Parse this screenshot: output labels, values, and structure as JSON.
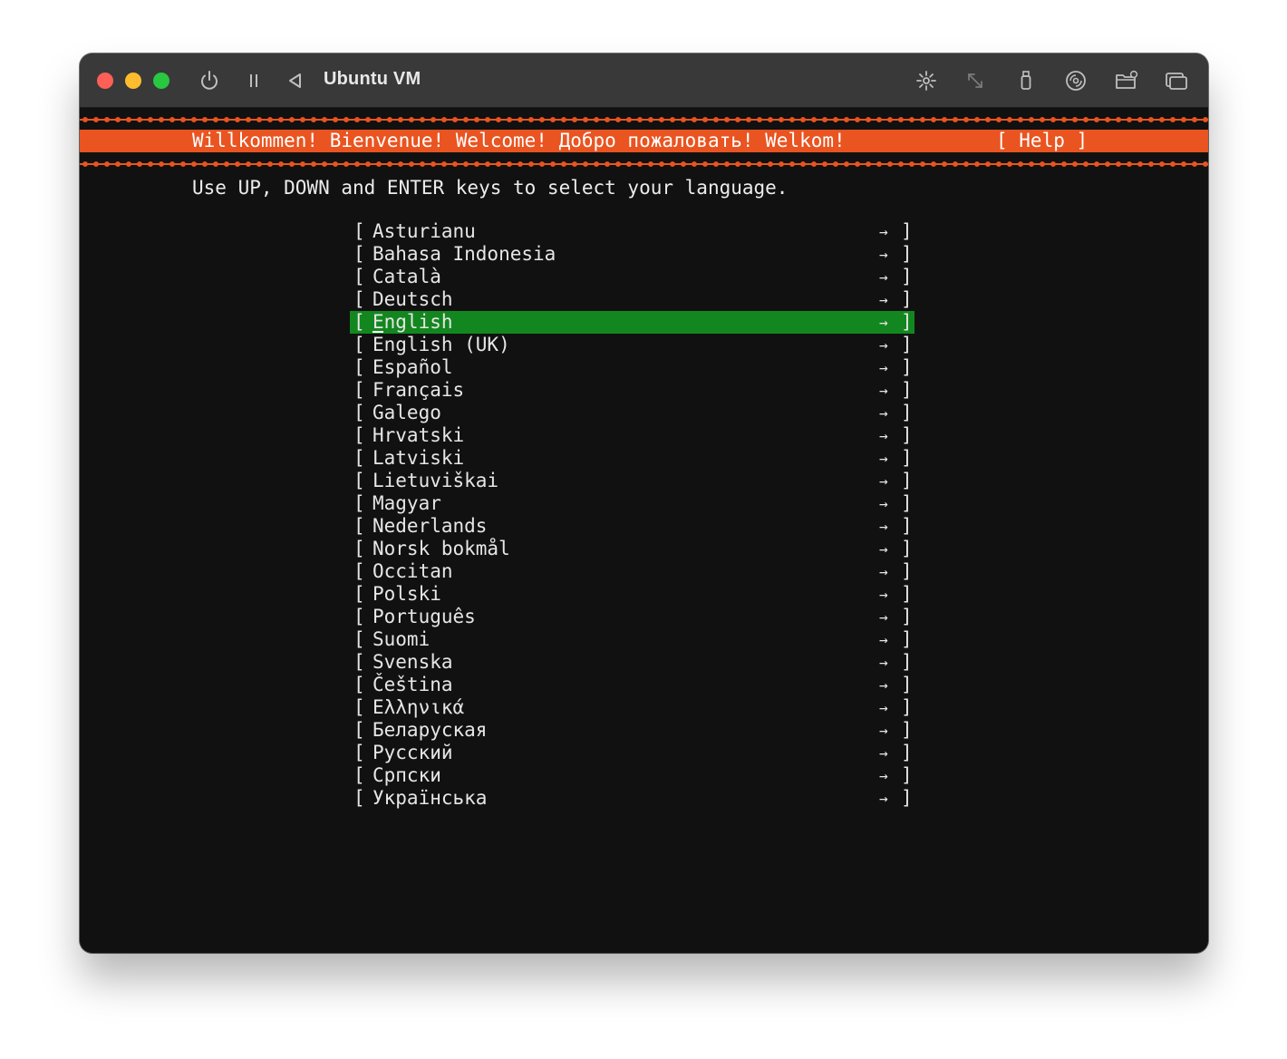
{
  "window": {
    "title": "Ubuntu VM"
  },
  "banner": {
    "welcome": "Willkommen! Bienvenue! Welcome! Добро пожаловать! Welkom!",
    "help": "[ Help ]"
  },
  "instruction": "Use UP, DOWN and ENTER keys to select your language.",
  "languages": [
    "Asturianu",
    "Bahasa Indonesia",
    "Català",
    "Deutsch",
    "English",
    "English (UK)",
    "Español",
    "Français",
    "Galego",
    "Hrvatski",
    "Latviski",
    "Lietuviškai",
    "Magyar",
    "Nederlands",
    "Norsk bokmål",
    "Occitan",
    "Polski",
    "Português",
    "Suomi",
    "Svenska",
    "Čeština",
    "Ελληνικά",
    "Беларуская",
    "Русский",
    "Српски",
    "Українська"
  ],
  "selected_language": "English",
  "item_left_bracket": "[",
  "item_right_bracket": "]",
  "item_arrow": "→",
  "colors": {
    "accent": "#e95420",
    "selection": "#13871f",
    "screen_bg": "#111111"
  },
  "icons": {
    "toolbar": [
      "power-icon",
      "pause-icon",
      "back-icon",
      "brightness-icon",
      "resize-icon",
      "usb-icon",
      "disc-icon",
      "shared-folder-icon",
      "window-icon"
    ]
  }
}
